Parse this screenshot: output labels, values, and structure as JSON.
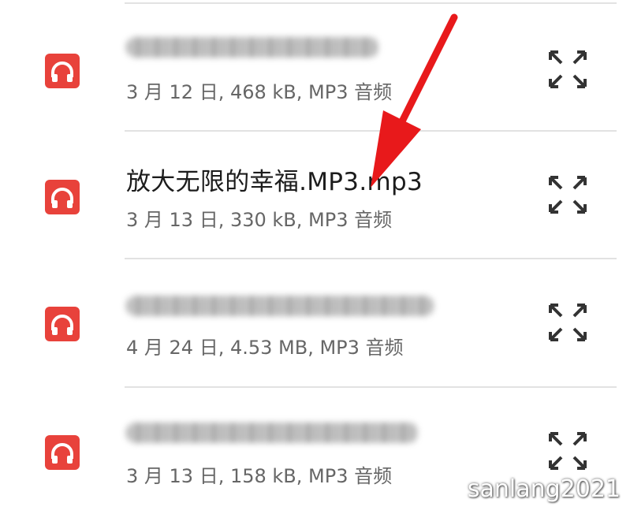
{
  "files": [
    {
      "name": "",
      "meta": "3 月 12 日, 468 kB, MP3 音频",
      "icon": "headphones-icon",
      "action_icon": "expand-icon"
    },
    {
      "name": "放大无限的幸福.MP3.mp3",
      "meta": "3 月 13 日, 330 kB, MP3 音频",
      "icon": "headphones-icon",
      "action_icon": "expand-icon"
    },
    {
      "name": "",
      "meta": "4 月 24 日, 4.53 MB, MP3 音频",
      "icon": "headphones-icon",
      "action_icon": "expand-icon"
    },
    {
      "name": "",
      "meta": "3 月 13 日, 158 kB, MP3 音频",
      "icon": "headphones-icon",
      "action_icon": "expand-icon"
    }
  ],
  "colors": {
    "icon_bg": "#e8423b",
    "annotation_arrow": "#e8191b",
    "text": "#1c1c1c",
    "meta_text": "#666666"
  },
  "annotation": {
    "type": "arrow",
    "points_to": "files.1.name"
  },
  "watermark": "sanlang2021"
}
